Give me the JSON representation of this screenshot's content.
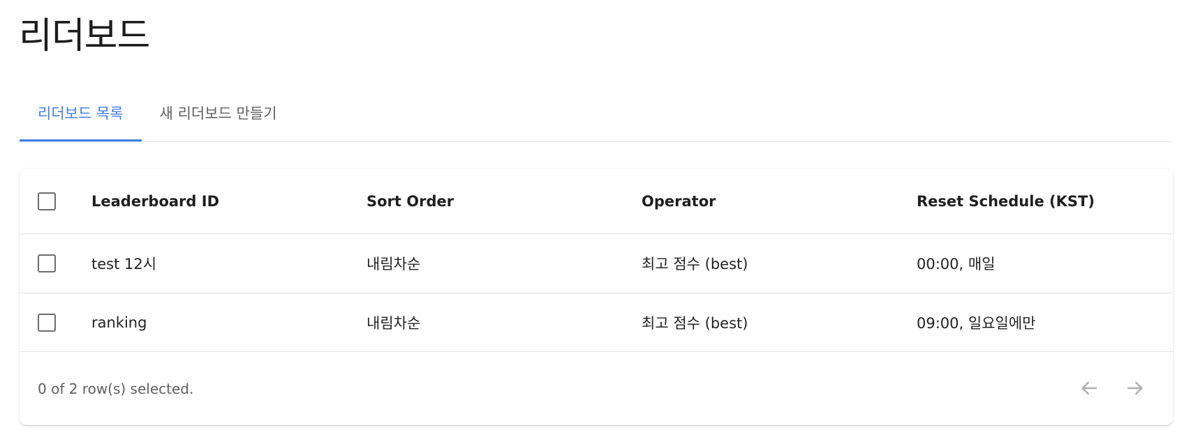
{
  "page": {
    "title": "리더보드"
  },
  "tabs": [
    {
      "label": "리더보드 목록",
      "active": true
    },
    {
      "label": "새 리더보드 만들기",
      "active": false
    }
  ],
  "table": {
    "columns": [
      "Leaderboard ID",
      "Sort Order",
      "Operator",
      "Reset Schedule (KST)"
    ],
    "rows": [
      {
        "id": "test 12시",
        "sort_order": "내림차순",
        "operator": "최고 점수 (best)",
        "reset_schedule": "00:00, 매일",
        "selected": false
      },
      {
        "id": "ranking",
        "sort_order": "내림차순",
        "operator": "최고 점수 (best)",
        "reset_schedule": "09:00, 일요일에만",
        "selected": false
      }
    ],
    "footer": {
      "selection_text": "0 of 2 row(s) selected."
    }
  },
  "pagination": {
    "prev_icon": "arrow-left-icon",
    "next_icon": "arrow-right-icon",
    "prev_enabled": false,
    "next_enabled": false
  },
  "colors": {
    "accent": "#3f7fe6",
    "disabled_icon": "#b0b0b0"
  }
}
